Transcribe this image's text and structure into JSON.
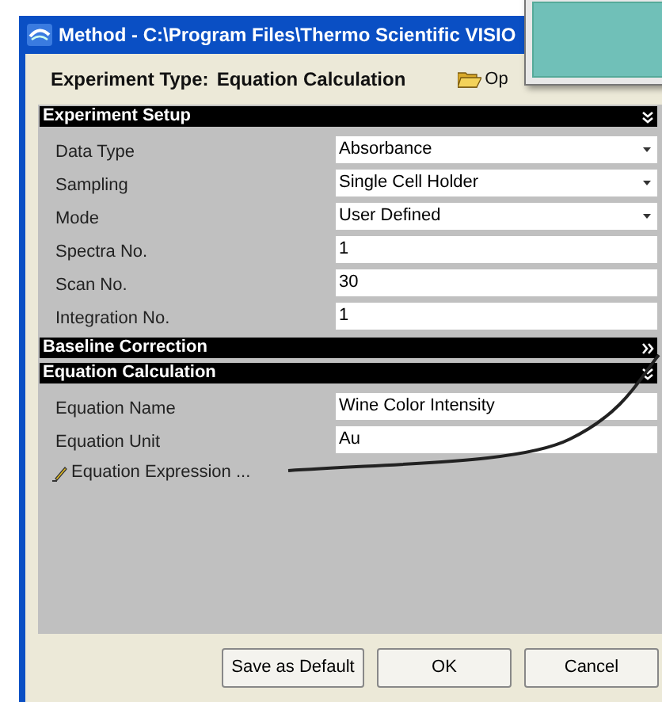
{
  "window": {
    "title": "Method - C:\\Program Files\\Thermo Scientific VISIO"
  },
  "header": {
    "experiment_type_label": "Experiment Type:",
    "experiment_type": "Equation Calculation",
    "open_label": "Op"
  },
  "sections": [
    {
      "title": "Experiment Setup",
      "expanded": true,
      "rows": [
        {
          "label": "Data Type",
          "kind": "dropdown",
          "value": "Absorbance"
        },
        {
          "label": "Sampling",
          "kind": "dropdown",
          "value": "Single Cell Holder"
        },
        {
          "label": "Mode",
          "kind": "dropdown",
          "value": "User Defined"
        },
        {
          "label": "Spectra No.",
          "kind": "text",
          "value": "1"
        },
        {
          "label": "Scan No.",
          "kind": "text",
          "value": "30"
        },
        {
          "label": "Integration No.",
          "kind": "text",
          "value": "1"
        }
      ]
    },
    {
      "title": "Baseline Correction",
      "expanded": false
    },
    {
      "title": "Equation Calculation",
      "expanded": true,
      "rows": [
        {
          "label": "Equation Name",
          "kind": "text",
          "value": "Wine Color Intensity"
        },
        {
          "label": "Equation Unit",
          "kind": "text",
          "value": "Au"
        },
        {
          "label": "Equation Expression ...",
          "kind": "link"
        }
      ]
    }
  ],
  "buttons": [
    "Save as Default",
    "OK",
    "Cancel"
  ]
}
